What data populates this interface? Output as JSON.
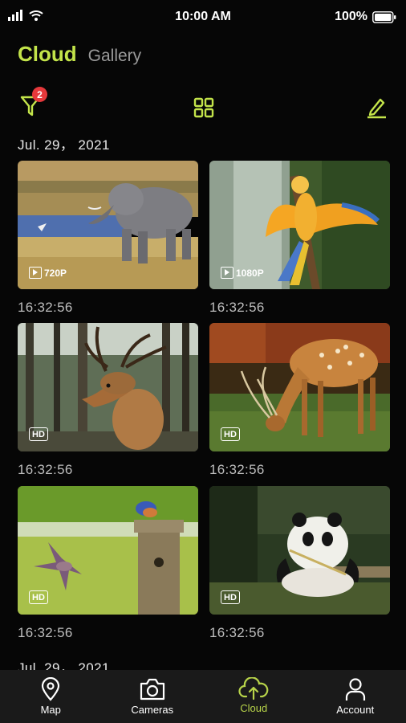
{
  "status": {
    "time": "10:00 AM",
    "battery": "100%"
  },
  "header": {
    "title": "Cloud",
    "subtitle": "Gallery"
  },
  "toolbar": {
    "filter_badge": "2"
  },
  "sections": [
    {
      "date": "Jul. 29， 2021",
      "items": [
        {
          "subject": "elephant",
          "tag": "720P",
          "video": true,
          "time": "16:32:56"
        },
        {
          "subject": "parrot",
          "tag": "1080P",
          "video": true,
          "time": "16:32:56"
        },
        {
          "subject": "deer",
          "tag": "HD",
          "video": false,
          "time": "16:32:56"
        },
        {
          "subject": "spotted-deer",
          "tag": "HD",
          "video": false,
          "time": "16:32:56"
        },
        {
          "subject": "birds",
          "tag": "HD",
          "video": false,
          "time": "16:32:56"
        },
        {
          "subject": "panda",
          "tag": "HD",
          "video": false,
          "time": "16:32:56"
        }
      ]
    },
    {
      "date": "Jul. 29， 2021",
      "items": []
    }
  ],
  "tabs": [
    {
      "label": "Map",
      "icon": "map-pin-icon",
      "active": false
    },
    {
      "label": "Cameras",
      "icon": "camera-icon",
      "active": false
    },
    {
      "label": "Cloud",
      "icon": "cloud-upload-icon",
      "active": true
    },
    {
      "label": "Account",
      "icon": "user-icon",
      "active": false
    }
  ],
  "colors": {
    "accent": "#c3e44a",
    "badge": "#e5383b",
    "background": "#060606",
    "tabbar": "#1a1a1a"
  }
}
